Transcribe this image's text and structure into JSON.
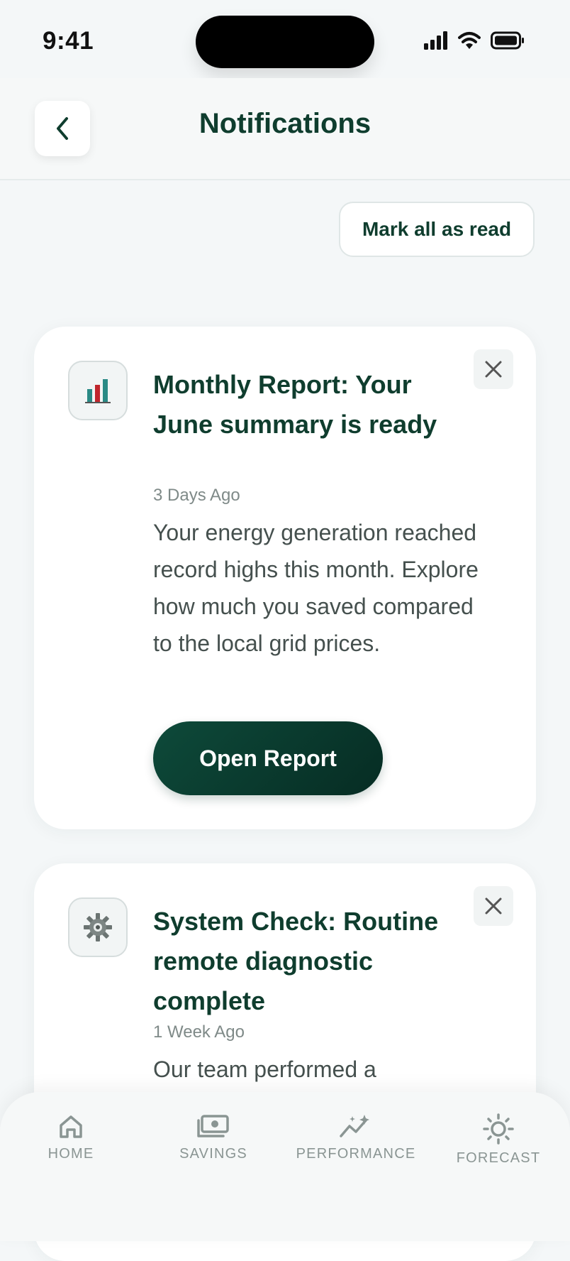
{
  "status_bar": {
    "time": "9:41"
  },
  "header": {
    "title": "Notifications",
    "back_icon": "chevron-left-icon"
  },
  "actions": {
    "mark_all_label": "Mark all as read"
  },
  "notifications": [
    {
      "icon": "bar-chart-icon",
      "title": "Monthly Report: Your June summary is ready",
      "time": "3 Days Ago",
      "body": "Your energy generation reached record highs this month. Explore how much you saved compared to the local grid prices.",
      "button_label": "Open Report"
    },
    {
      "icon": "gear-icon",
      "title": "System Check: Routine remote diagnostic complete",
      "time": "1 Week Ago",
      "body": "Our team performed a"
    }
  ],
  "tabs": [
    {
      "label": "HOME",
      "icon": "home-icon"
    },
    {
      "label": "SAVINGS",
      "icon": "cash-icon"
    },
    {
      "label": "PERFORMANCE",
      "icon": "performance-icon"
    },
    {
      "label": "FORECAST",
      "icon": "sun-icon"
    }
  ],
  "colors": {
    "primary": "#0f3d2e",
    "button_gradient_start": "#0e4a3a",
    "button_gradient_end": "#062c23",
    "background": "#f4f7f8",
    "muted_text": "#7f8a88",
    "chart_red": "#c0262d",
    "chart_teal": "#2a8a85"
  }
}
